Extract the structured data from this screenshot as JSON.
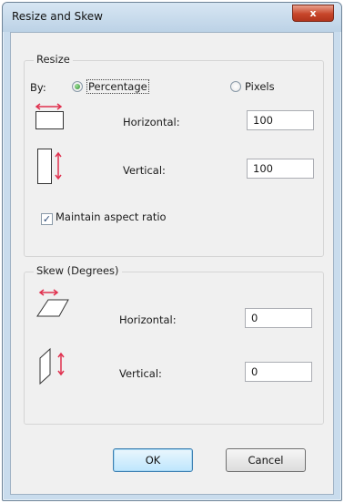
{
  "window": {
    "title": "Resize and Skew",
    "close_glyph": "x"
  },
  "resize": {
    "group_label": "Resize",
    "by_label": "By:",
    "percentage_label": "Percentage",
    "pixels_label": "Pixels",
    "selected_unit": "Percentage",
    "horizontal_label": "Horizontal:",
    "horizontal_value": "100",
    "vertical_label": "Vertical:",
    "vertical_value": "100",
    "maintain_label": "Maintain aspect ratio",
    "maintain_checked": true,
    "check_glyph": "✓"
  },
  "skew": {
    "group_label": "Skew (Degrees)",
    "horizontal_label": "Horizontal:",
    "horizontal_value": "0",
    "vertical_label": "Vertical:",
    "vertical_value": "0"
  },
  "buttons": {
    "ok_label": "OK",
    "cancel_label": "Cancel"
  },
  "colors": {
    "accent_arrow": "#e0304e",
    "titlebar": "#c9dced",
    "close": "#c7462a"
  }
}
